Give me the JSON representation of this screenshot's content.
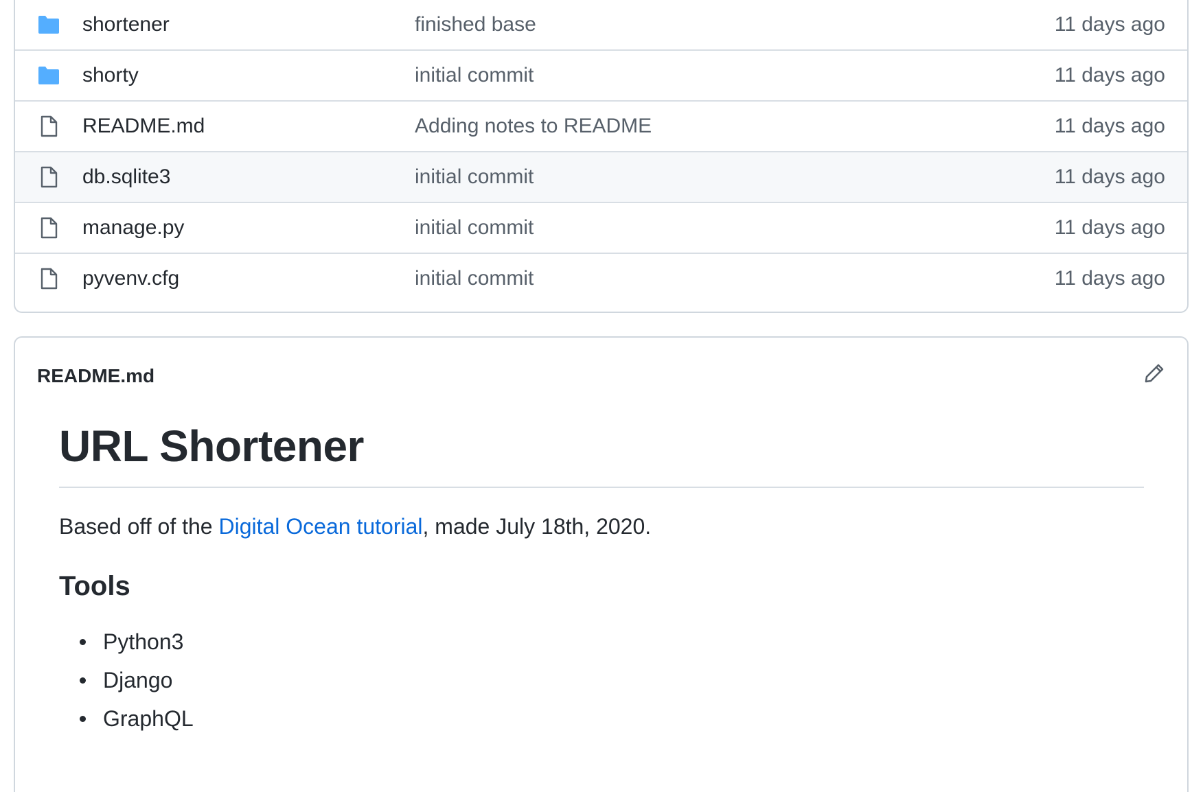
{
  "files": [
    {
      "type": "folder",
      "icon": "folder-icon",
      "name": "shortener",
      "commit": "finished base",
      "age": "11 days ago"
    },
    {
      "type": "folder",
      "icon": "folder-icon",
      "name": "shorty",
      "commit": "initial commit",
      "age": "11 days ago"
    },
    {
      "type": "file",
      "icon": "file-icon",
      "name": "README.md",
      "commit": "Adding notes to README",
      "age": "11 days ago"
    },
    {
      "type": "file",
      "icon": "file-icon",
      "name": "db.sqlite3",
      "commit": "initial commit",
      "age": "11 days ago"
    },
    {
      "type": "file",
      "icon": "file-icon",
      "name": "manage.py",
      "commit": "initial commit",
      "age": "11 days ago"
    },
    {
      "type": "file",
      "icon": "file-icon",
      "name": "pyvenv.cfg",
      "commit": "initial commit",
      "age": "11 days ago"
    }
  ],
  "readme": {
    "filename": "README.md",
    "edit_icon": "pencil-icon",
    "title": "URL Shortener",
    "intro_before": "Based off of the ",
    "intro_link": "Digital Ocean tutorial",
    "intro_after": ", made July 18th, 2020.",
    "tools_heading": "Tools",
    "tools": [
      "Python3",
      "Django",
      "GraphQL"
    ]
  },
  "colors": {
    "folder": "#54aeff",
    "link": "#0969da",
    "muted_text": "#57606a",
    "border": "#d0d7de",
    "hover_row": "#f6f8fa"
  }
}
